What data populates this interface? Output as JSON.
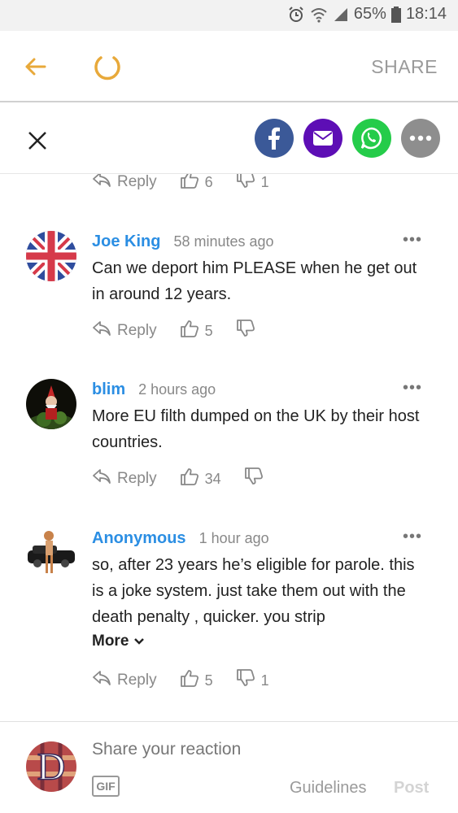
{
  "status_bar": {
    "battery": "65%",
    "time": "18:14"
  },
  "app_bar": {
    "share_label": "SHARE"
  },
  "share_bar": {
    "icons": [
      "facebook-icon",
      "mail-icon",
      "whatsapp-icon",
      "more-icon"
    ]
  },
  "comments": [
    {
      "partial": true,
      "reply": "Reply",
      "likes": "6",
      "dislikes": "1"
    },
    {
      "name": "Joe King",
      "time": "58 minutes ago",
      "text": "Can we deport him PLEASE when he get out in around 12 years.",
      "reply": "Reply",
      "likes": "5",
      "dislikes": ""
    },
    {
      "name": "blim",
      "time": "2 hours ago",
      "text": "More EU filth dumped on the UK by their host countries.",
      "reply": "Reply",
      "likes": "34",
      "dislikes": ""
    },
    {
      "name": "Anonymous",
      "time": "1 hour ago",
      "text": "so, after 23 years he’s eligible for parole. this is a joke system. just take them out with the death penalty , quicker. you strip",
      "more": "More",
      "reply": "Reply",
      "likes": "5",
      "dislikes": "1"
    }
  ],
  "composer": {
    "placeholder": "Share your reaction",
    "gif": "GIF",
    "guidelines": "Guidelines",
    "post": "Post",
    "avatar_letter": "D"
  },
  "colors": {
    "accent": "#e8a93a",
    "name_blue": "#2b8ee3",
    "facebook": "#3b5998",
    "mail": "#5d0eb5",
    "whatsapp": "#25cc4a",
    "more": "#8e8e8e"
  }
}
